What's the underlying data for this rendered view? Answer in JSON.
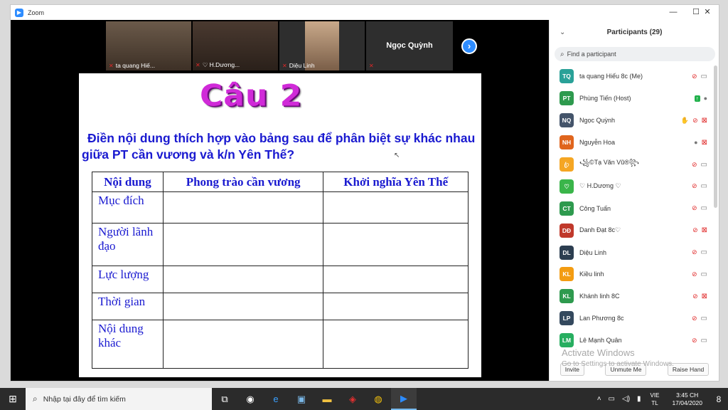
{
  "window": {
    "title": "Zoom",
    "minimize": "—",
    "maximize": "☐",
    "close": "✕"
  },
  "video_tiles": [
    {
      "name": "ta quang Hiế...",
      "bg": "#5a4a3c"
    },
    {
      "name": "♡ H.Dương...",
      "bg": "#3a2e26"
    },
    {
      "name": "Diệu Linh",
      "bg": "#6a5a48"
    },
    {
      "name": "",
      "big_name": "Ngọc Quỳnh",
      "bg": "#232323"
    }
  ],
  "slide": {
    "title": "Câu 2",
    "question": "Điền nội dung thích hợp vào bảng sau để phân biệt sự khác nhau giữa PT cần vương và k/n Yên Thế?",
    "table": {
      "headers": [
        "Nội dung",
        "Phong trào cần vương",
        "Khởi nghĩa Yên Thế"
      ],
      "rows": [
        "Mục đích",
        "Người lãnh đạo",
        "Lực lượng",
        "Thời gian",
        "Nội dung khác"
      ]
    }
  },
  "participants": {
    "title": "Participants (29)",
    "search_placeholder": "Find a participant",
    "list": [
      {
        "initials": "TQ",
        "name": "ta quang Hiếu 8c (Me)",
        "color": "#2aa198",
        "mic": "off",
        "cam": "on"
      },
      {
        "initials": "PT",
        "name": "Phùng Tiến (Host)",
        "color": "#2e9a4e",
        "mic": "on",
        "cam": "share"
      },
      {
        "initials": "NQ",
        "name": "Ngọc Quỳnh",
        "color": "#44546a",
        "mic": "off",
        "cam": "off",
        "hand": true
      },
      {
        "initials": "NH",
        "name": "Nguyễn Hoa",
        "color": "#e0651d",
        "mic": "on",
        "cam": "off"
      },
      {
        "initials": "ꦿ",
        "name": "꧁©Tạ Văn Vũ®꧂",
        "color": "#f5a623",
        "mic": "off",
        "cam": "on"
      },
      {
        "initials": "♡",
        "name": "♡ H.Dương ♡",
        "color": "#3ab54a",
        "mic": "off",
        "cam": "on"
      },
      {
        "initials": "CT",
        "name": "Công Tuấn",
        "color": "#2e9a4e",
        "mic": "off",
        "cam": "on"
      },
      {
        "initials": "DĐ",
        "name": "Danh Đạt 8c♡",
        "color": "#c0392b",
        "mic": "off",
        "cam": "off"
      },
      {
        "initials": "DL",
        "name": "Diệu Linh",
        "color": "#2c3e50",
        "mic": "off",
        "cam": "on"
      },
      {
        "initials": "KL",
        "name": "Kiều linh",
        "color": "#f39c12",
        "mic": "off",
        "cam": "on"
      },
      {
        "initials": "KL",
        "name": "Khánh linh 8C",
        "color": "#2e9a4e",
        "mic": "off",
        "cam": "off"
      },
      {
        "initials": "LP",
        "name": "Lan Phương 8c",
        "color": "#34495e",
        "mic": "off",
        "cam": "on"
      },
      {
        "initials": "LM",
        "name": "Lê Mạnh Quân",
        "color": "#27ae60",
        "mic": "off",
        "cam": "on"
      }
    ],
    "footer": {
      "invite": "Invite",
      "unmute": "Unmute Me",
      "raise_hand": "Raise Hand"
    }
  },
  "watermark": {
    "line1": "Activate Windows",
    "line2": "Go to Settings to activate Windows."
  },
  "taskbar": {
    "search_placeholder": "Nhập tại đây để tìm kiếm",
    "lang_line1": "VIE",
    "lang_line2": "TL",
    "time": "3:45 CH",
    "date": "17/04/2020",
    "notif_count": "8"
  }
}
